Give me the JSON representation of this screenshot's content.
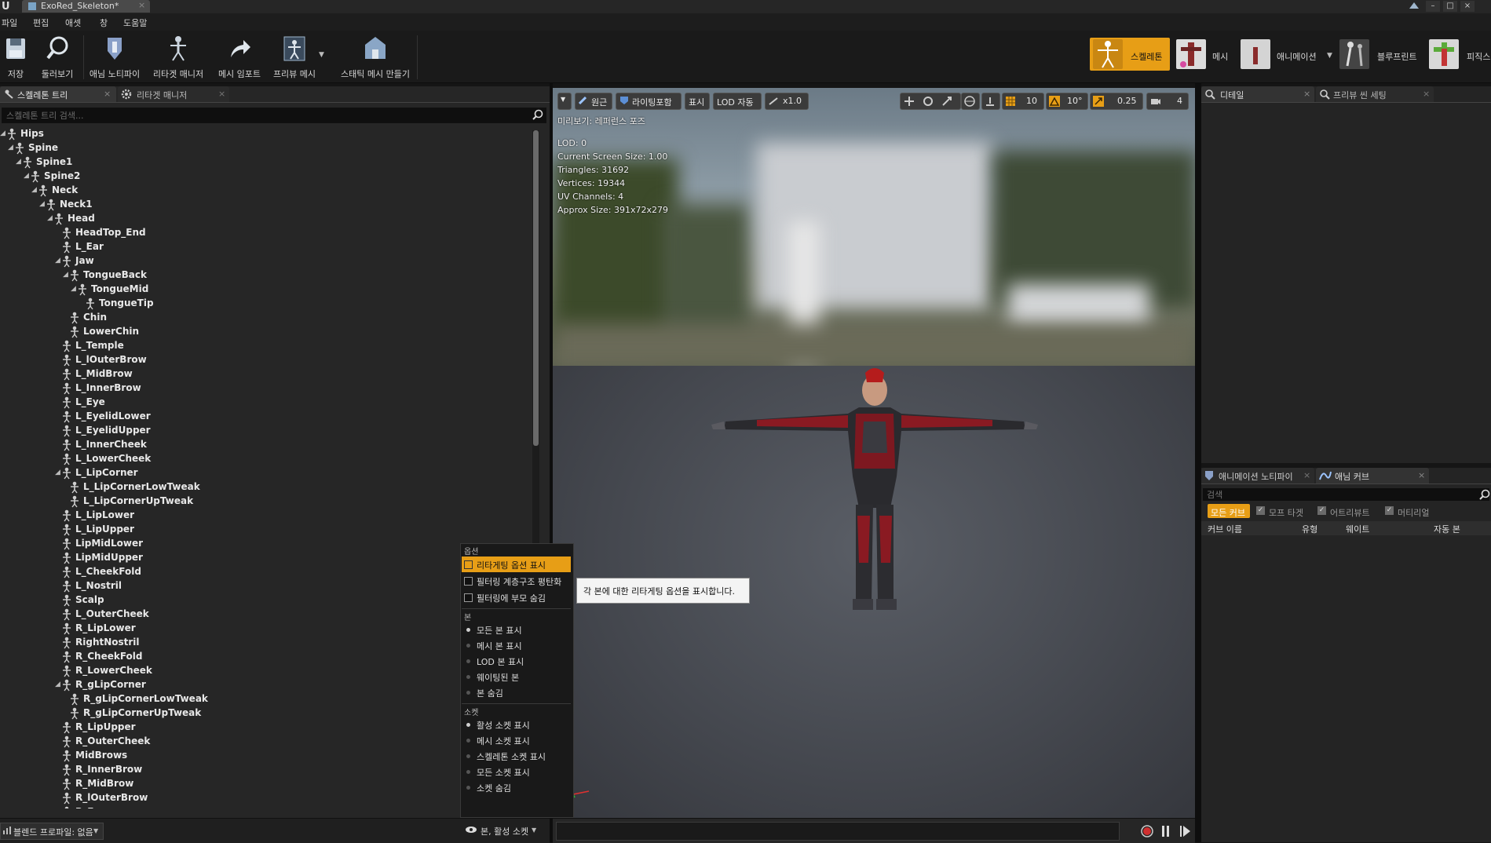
{
  "titlebar": {
    "tab_label": "ExoRed_Skeleton*"
  },
  "menu": [
    "파일",
    "편집",
    "애셋",
    "창",
    "도움말"
  ],
  "toolbar": {
    "buttons": [
      "저장",
      "둘러보기",
      "애님 노티파이",
      "리타겟 매니저",
      "메시 임포트",
      "프리뷰 메시",
      "스태틱 메시 만들기"
    ],
    "modes": [
      "스켈레톤",
      "메시",
      "애니메이션",
      "블루프린트",
      "피직스"
    ]
  },
  "left_panel": {
    "tabs": [
      "스켈레톤 트리",
      "리타겟 매니저"
    ],
    "search_placeholder": "스켈레톤 트리 검색...",
    "bones": [
      {
        "name": "Hips",
        "depth": 0,
        "arrow": true
      },
      {
        "name": "Spine",
        "depth": 1,
        "arrow": true
      },
      {
        "name": "Spine1",
        "depth": 2,
        "arrow": true
      },
      {
        "name": "Spine2",
        "depth": 3,
        "arrow": true
      },
      {
        "name": "Neck",
        "depth": 4,
        "arrow": true
      },
      {
        "name": "Neck1",
        "depth": 5,
        "arrow": true
      },
      {
        "name": "Head",
        "depth": 6,
        "arrow": true
      },
      {
        "name": "HeadTop_End",
        "depth": 7,
        "arrow": false
      },
      {
        "name": "L_Ear",
        "depth": 7,
        "arrow": false
      },
      {
        "name": "Jaw",
        "depth": 7,
        "arrow": true
      },
      {
        "name": "TongueBack",
        "depth": 8,
        "arrow": true
      },
      {
        "name": "TongueMid",
        "depth": 9,
        "arrow": true
      },
      {
        "name": "TongueTip",
        "depth": 10,
        "arrow": false
      },
      {
        "name": "Chin",
        "depth": 8,
        "arrow": false
      },
      {
        "name": "LowerChin",
        "depth": 8,
        "arrow": false
      },
      {
        "name": "L_Temple",
        "depth": 7,
        "arrow": false
      },
      {
        "name": "L_lOuterBrow",
        "depth": 7,
        "arrow": false
      },
      {
        "name": "L_MidBrow",
        "depth": 7,
        "arrow": false
      },
      {
        "name": "L_InnerBrow",
        "depth": 7,
        "arrow": false
      },
      {
        "name": "L_Eye",
        "depth": 7,
        "arrow": false
      },
      {
        "name": "L_EyelidLower",
        "depth": 7,
        "arrow": false
      },
      {
        "name": "L_EyelidUpper",
        "depth": 7,
        "arrow": false
      },
      {
        "name": "L_InnerCheek",
        "depth": 7,
        "arrow": false
      },
      {
        "name": "L_LowerCheek",
        "depth": 7,
        "arrow": false
      },
      {
        "name": "L_LipCorner",
        "depth": 7,
        "arrow": true
      },
      {
        "name": "L_LipCornerLowTweak",
        "depth": 8,
        "arrow": false
      },
      {
        "name": "L_LipCornerUpTweak",
        "depth": 8,
        "arrow": false
      },
      {
        "name": "L_LipLower",
        "depth": 7,
        "arrow": false
      },
      {
        "name": "L_LipUpper",
        "depth": 7,
        "arrow": false
      },
      {
        "name": "LipMidLower",
        "depth": 7,
        "arrow": false
      },
      {
        "name": "LipMidUpper",
        "depth": 7,
        "arrow": false
      },
      {
        "name": "L_CheekFold",
        "depth": 7,
        "arrow": false
      },
      {
        "name": "L_Nostril",
        "depth": 7,
        "arrow": false
      },
      {
        "name": "Scalp",
        "depth": 7,
        "arrow": false
      },
      {
        "name": "L_OuterCheek",
        "depth": 7,
        "arrow": false
      },
      {
        "name": "R_LipLower",
        "depth": 7,
        "arrow": false
      },
      {
        "name": "RightNostril",
        "depth": 7,
        "arrow": false
      },
      {
        "name": "R_CheekFold",
        "depth": 7,
        "arrow": false
      },
      {
        "name": "R_LowerCheek",
        "depth": 7,
        "arrow": false
      },
      {
        "name": "R_gLipCorner",
        "depth": 7,
        "arrow": true
      },
      {
        "name": "R_gLipCornerLowTweak",
        "depth": 8,
        "arrow": false
      },
      {
        "name": "R_gLipCornerUpTweak",
        "depth": 8,
        "arrow": false
      },
      {
        "name": "R_LipUpper",
        "depth": 7,
        "arrow": false
      },
      {
        "name": "R_OuterCheek",
        "depth": 7,
        "arrow": false
      },
      {
        "name": "MidBrows",
        "depth": 7,
        "arrow": false
      },
      {
        "name": "R_InnerBrow",
        "depth": 7,
        "arrow": false
      },
      {
        "name": "R_MidBrow",
        "depth": 7,
        "arrow": false
      },
      {
        "name": "R_lOuterBrow",
        "depth": 7,
        "arrow": false
      },
      {
        "name": "R_Eye",
        "depth": 7,
        "arrow": false
      }
    ],
    "blend_profile_label": "블렌드 프로파일: 없음",
    "bone_filter_label": "본, 활성 소켓"
  },
  "dropdown": {
    "options_header": "옵션",
    "options": [
      "리타게팅 옵션 표시",
      "필터링 계층구조 평탄화",
      "필터링에 부모 숨김"
    ],
    "bone_header": "본",
    "bone_items": [
      "모든 본 표시",
      "메시 본 표시",
      "LOD 본 표시",
      "웨이팅된 본",
      "본 숨김"
    ],
    "socket_header": "소켓",
    "socket_items": [
      "활성 소켓 표시",
      "메시 소켓 표시",
      "스켈레톤 소켓 표시",
      "모든 소켓 표시",
      "소켓 숨김"
    ],
    "tooltip": "각 본에 대한 리타게팅 옵션을 표시합니다."
  },
  "viewport": {
    "buttons": {
      "perspective": "원근",
      "lighting": "라이팅포함",
      "show": "표시",
      "lod": "LOD 자동",
      "speed": "x1.0"
    },
    "grid_snap": "10",
    "rot_snap": "10°",
    "scale_snap": "0.25",
    "cam_speed": "4",
    "preview_label": "미리보기: 레퍼런스 포즈",
    "info": [
      "LOD: 0",
      "Current Screen Size: 1.00",
      "Triangles: 31692",
      "Vertices: 19344",
      "UV Channels: 4",
      "Approx Size: 391x72x279"
    ]
  },
  "right_top": {
    "tabs": [
      "디테일",
      "프리뷰 씬 세팅"
    ]
  },
  "right_bottom": {
    "tabs": [
      "애니메이션 노티파이",
      "애님 커브"
    ],
    "search_placeholder": "검색",
    "filters": [
      "모든 커브",
      "모프 타겟",
      "어트리뷰트",
      "머티리얼"
    ],
    "columns": [
      "커브 이름",
      "유형",
      "웨이트",
      "자동 본"
    ]
  },
  "colors": {
    "accent": "#e79e16",
    "panel": "#262626",
    "background": "#151515"
  }
}
